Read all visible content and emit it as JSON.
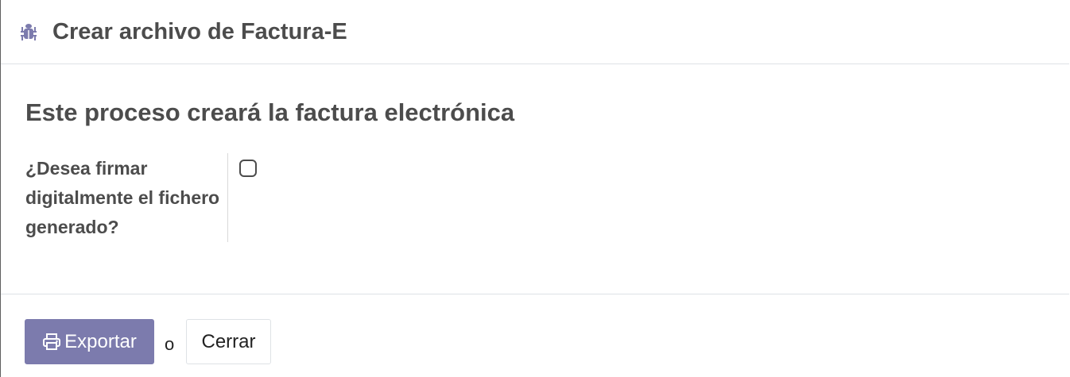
{
  "header": {
    "title": "Crear archivo de Factura-E",
    "icon": "bug-icon"
  },
  "body": {
    "heading": "Este proceso creará la factura electrónica",
    "field": {
      "label": "¿Desea firmar digitalmente el fichero generado?",
      "checked": false
    }
  },
  "footer": {
    "export_label": "Exportar",
    "export_icon": "print-icon",
    "or_text": "o",
    "close_label": "Cerrar"
  },
  "colors": {
    "primary": "#7c7bad",
    "text": "#4c4c4c"
  }
}
